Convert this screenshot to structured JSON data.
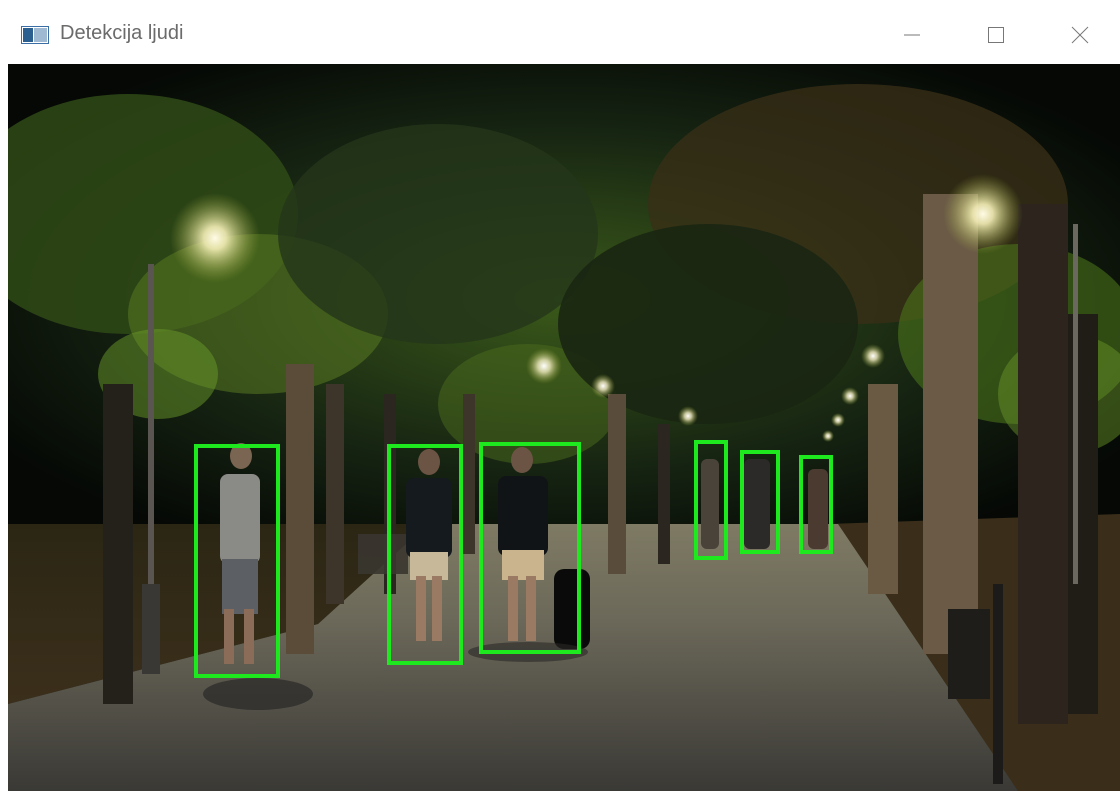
{
  "window": {
    "title": "Detekcija ljudi",
    "controls": [
      "minimize-icon",
      "maximize-icon",
      "close-icon"
    ]
  },
  "viewport": {
    "content": "image",
    "detection_box_color": "#1ee81e"
  },
  "detections": [
    {
      "label": "person"
    },
    {
      "label": "person"
    },
    {
      "label": "person"
    },
    {
      "label": "person"
    },
    {
      "label": "person"
    },
    {
      "label": "person"
    }
  ]
}
